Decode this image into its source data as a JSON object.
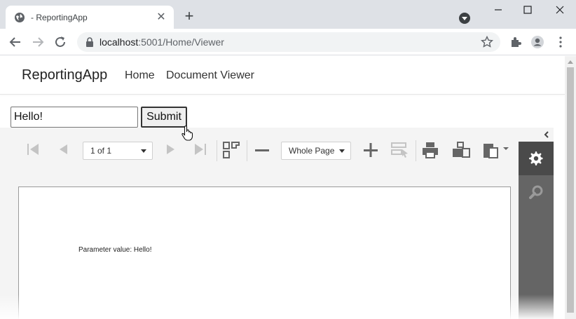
{
  "browser": {
    "tab_title": "- ReportingApp",
    "url_host": "localhost",
    "url_rest": ":5001/Home/Viewer"
  },
  "app": {
    "brand": "ReportingApp",
    "nav": [
      "Home",
      "Document Viewer"
    ]
  },
  "form": {
    "input_value": "Hello!",
    "submit_label": "Submit"
  },
  "viewer": {
    "page_selector": "1 of 1",
    "zoom": "Whole Page",
    "report_text": "Parameter value: Hello!"
  },
  "colors": {
    "toolbar_icon": "#666666",
    "disabled_icon": "#c4c4c4",
    "side_panel": "#656565",
    "side_active": "#4a4a4a"
  }
}
